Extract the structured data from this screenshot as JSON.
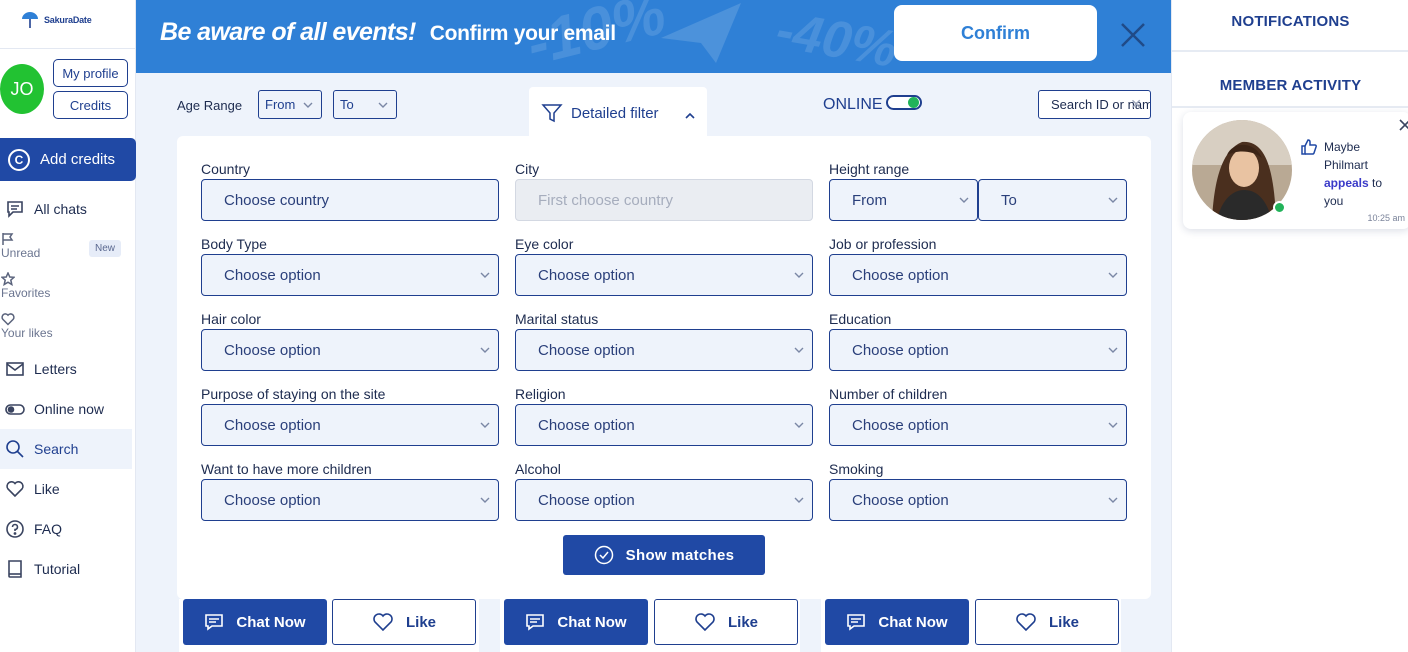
{
  "brand": {
    "name": "SakuraDate",
    "accent": "#2049a5",
    "banner_blue": "#2f80d6"
  },
  "sidebar": {
    "avatar_initials": "JO",
    "my_profile": "My profile",
    "credits": "Credits",
    "add_credits": "Add credits",
    "items": {
      "all_chats": "All chats",
      "unread": "Unread",
      "unread_badge": "New",
      "favorites": "Favorites",
      "your_likes": "Your likes",
      "letters": "Letters",
      "online_now": "Online now",
      "search": "Search",
      "like": "Like",
      "faq": "FAQ",
      "tutorial": "Tutorial"
    }
  },
  "banner": {
    "headline": "Be aware of all events!",
    "subline": "Confirm your email",
    "confirm": "Confirm",
    "deco": [
      "-10%",
      "-40%"
    ]
  },
  "filter_bar": {
    "age_range_label": "Age Range",
    "age_from": "From",
    "age_to": "To",
    "detailed_filter": "Detailed filter",
    "online_label": "ONLINE",
    "online_enabled": true,
    "search_placeholder": "Search ID or name"
  },
  "panel": {
    "country": {
      "label": "Country",
      "placeholder": "Choose country"
    },
    "city": {
      "label": "City",
      "placeholder": "First choose country"
    },
    "height": {
      "label": "Height range",
      "from": "From",
      "to": "To"
    },
    "body_type": {
      "label": "Body Type",
      "value": "Choose option"
    },
    "eye_color": {
      "label": "Eye color",
      "value": "Choose option"
    },
    "job": {
      "label": "Job or profession",
      "value": "Choose option"
    },
    "hair_color": {
      "label": "Hair color",
      "value": "Choose option"
    },
    "marital": {
      "label": "Marital status",
      "value": "Choose option"
    },
    "education": {
      "label": "Education",
      "value": "Choose option"
    },
    "purpose": {
      "label": "Purpose of staying on the site",
      "value": "Choose option"
    },
    "religion": {
      "label": "Religion",
      "value": "Choose option"
    },
    "children": {
      "label": "Number of children",
      "value": "Choose option"
    },
    "more_children": {
      "label": "Want to have more children",
      "value": "Choose option"
    },
    "alcohol": {
      "label": "Alcohol",
      "value": "Choose option"
    },
    "smoking": {
      "label": "Smoking",
      "value": "Choose option"
    },
    "show_matches": "Show matches"
  },
  "cards": {
    "chat_now": "Chat Now",
    "like": "Like"
  },
  "right_panel": {
    "notifications": "NOTIFICATIONS",
    "member_activity": "MEMBER ACTIVITY",
    "notification": {
      "prefix": "Maybe",
      "name": "Philmart",
      "action": "appeals",
      "suffix": "to you",
      "time": "10:25 am"
    }
  }
}
